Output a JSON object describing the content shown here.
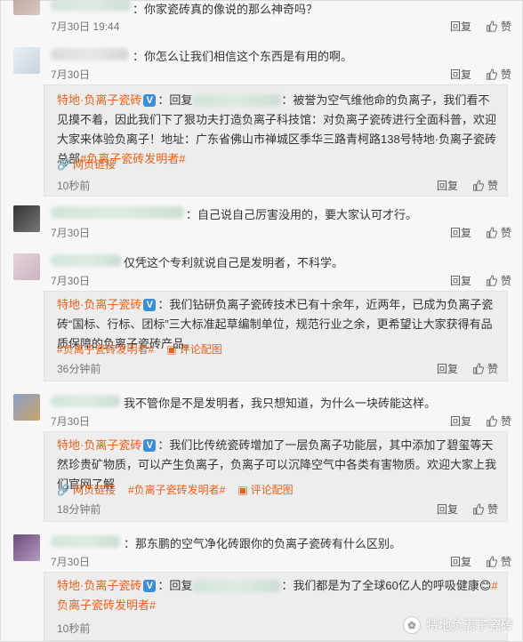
{
  "labels": {
    "reply": "回复",
    "like": "赞"
  },
  "comments": [
    {
      "name": "",
      "text": "：你家瓷砖真的像说的那么神奇吗？",
      "date": "7月30日 19:44"
    },
    {
      "name": "",
      "text": "：你怎么让我们相信这个东西是有用的啊。",
      "date": "7月30日"
    },
    {
      "name": "",
      "text": "：自己说自己厉害没用的，要大家认可才行。",
      "date": "7月30日"
    },
    {
      "name": "",
      "text": "仅凭这个专利就说自己是发明者，不科学。",
      "date": "7月30日"
    },
    {
      "name": "",
      "text": "我不管你是不是发明者，我只想知道，为什么一块砖能这样。",
      "date": "7月30日"
    },
    {
      "name": "",
      "text": "：那东鹏的空气净化砖跟你的负离子瓷砖有什么区别。",
      "date": "7月30日"
    }
  ],
  "replies": [
    {
      "author": "特地·负离子瓷砖",
      "prefix": "：回复",
      "body": "：被誉为空气维他命的负离子，我们看不见摸不着，因此我们下了狠功夫打造负离子科技馆：对负离子瓷砖进行全面科普，欢迎大家来体验负离子！地址：广东省佛山市禅城区季华三路青柯路138号特地·负离子瓷砖总部",
      "tag": "#负离子瓷砖发明者#",
      "links": [
        "网页链接"
      ],
      "time": "10秒前"
    },
    {
      "author": "特地·负离子瓷砖",
      "prefix": "：",
      "body": "我们钻研负离子瓷砖技术已有十余年，近两年，已成为负离子瓷砖“国标、行标、团标”三大标准起草编制单位，规范行业之余，更希望让大家获得有品质保障的负离子瓷砖产品。",
      "tag": "#负离子瓷砖发明者#",
      "links": [
        "评论配图"
      ],
      "time": "36分钟前"
    },
    {
      "author": "特地·负离子瓷砖",
      "prefix": "：",
      "body": "我们比传统瓷砖增加了一层负离子功能层，其中添加了碧玺等天然珍贵矿物质，可以产生负离子，负离子可以沉降空气中各类有害物质。欢迎大家上我们官网了解",
      "tag": "#负离子瓷砖发明者#",
      "links": [
        "网页链接",
        "评论配图"
      ],
      "time": "18分钟前"
    },
    {
      "author": "特地·负离子瓷砖",
      "prefix": "：回复",
      "body": "：我们都是为了全球60亿人的呼吸健康",
      "tag": "#负离子瓷砖发明者#",
      "links": [],
      "time": "10秒前"
    }
  ],
  "watermark": "特地负离子瓷砖",
  "colors": {
    "accent": "#e8611a",
    "verified": "#3b8ed8"
  }
}
